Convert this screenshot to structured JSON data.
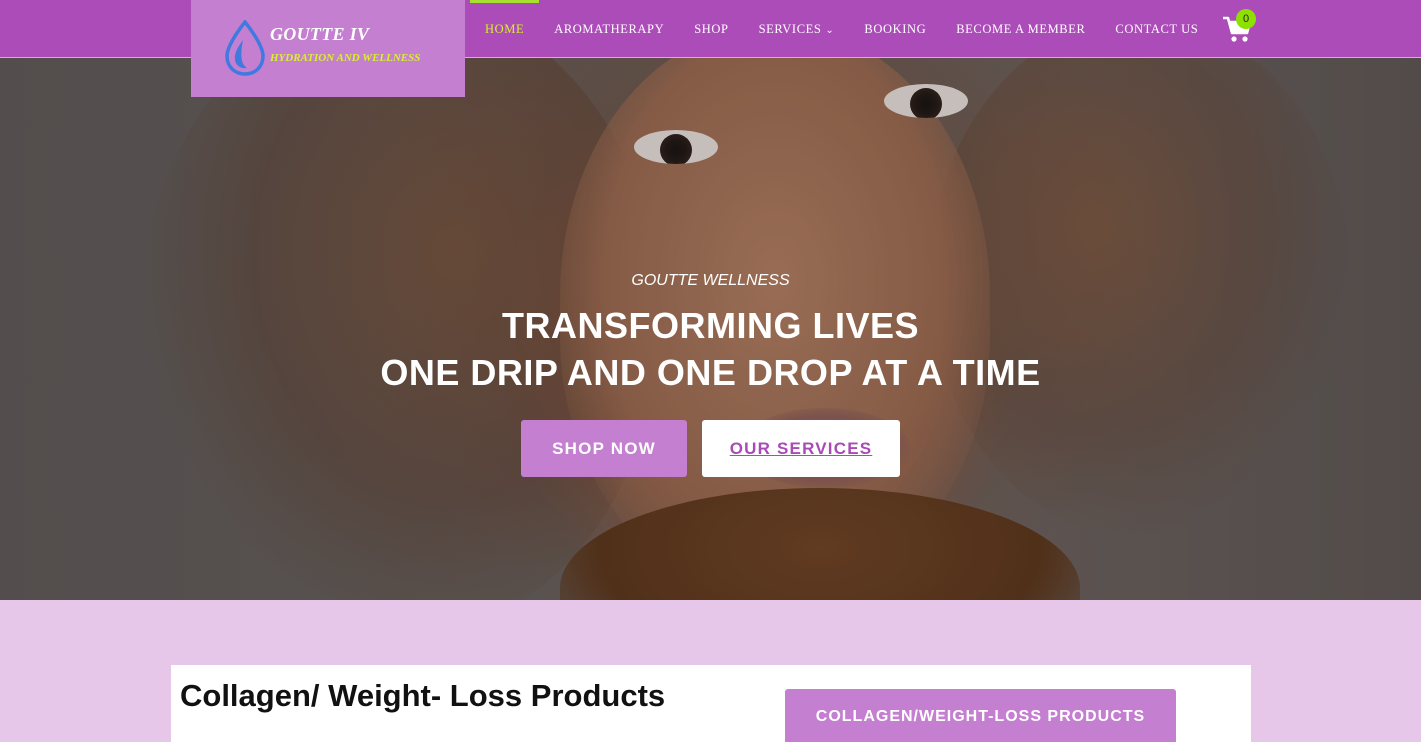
{
  "brand": {
    "name": "GOUTTE IV",
    "tagline": "HYDRATION AND WELLNESS",
    "colors": {
      "nav_bg": "#ac4cb9",
      "logo_bg": "#c47fd0",
      "accent": "#d9f02a",
      "drop": "#3f7ae0"
    }
  },
  "nav": {
    "items": [
      {
        "label": "HOME",
        "active": true
      },
      {
        "label": "AROMATHERAPY"
      },
      {
        "label": "SHOP"
      },
      {
        "label": "SERVICES",
        "has_dropdown": true,
        "icon": "chevron-down-icon"
      },
      {
        "label": "BOOKING"
      },
      {
        "label": "BECOME A MEMBER"
      },
      {
        "label": "CONTACT US"
      }
    ],
    "cart": {
      "icon": "cart-icon",
      "count": "0"
    }
  },
  "hero": {
    "kicker": "GOUTTE WELLNESS",
    "title_line1": "TRANSFORMING LIVES",
    "title_line2": "ONE DRIP AND ONE DROP AT A TIME",
    "buttons": {
      "shop": "SHOP NOW",
      "services": "OUR SERVICES"
    }
  },
  "products": {
    "heading": "Collagen/ Weight- Loss Products",
    "button": "COLLAGEN/WEIGHT-LOSS PRODUCTS"
  }
}
